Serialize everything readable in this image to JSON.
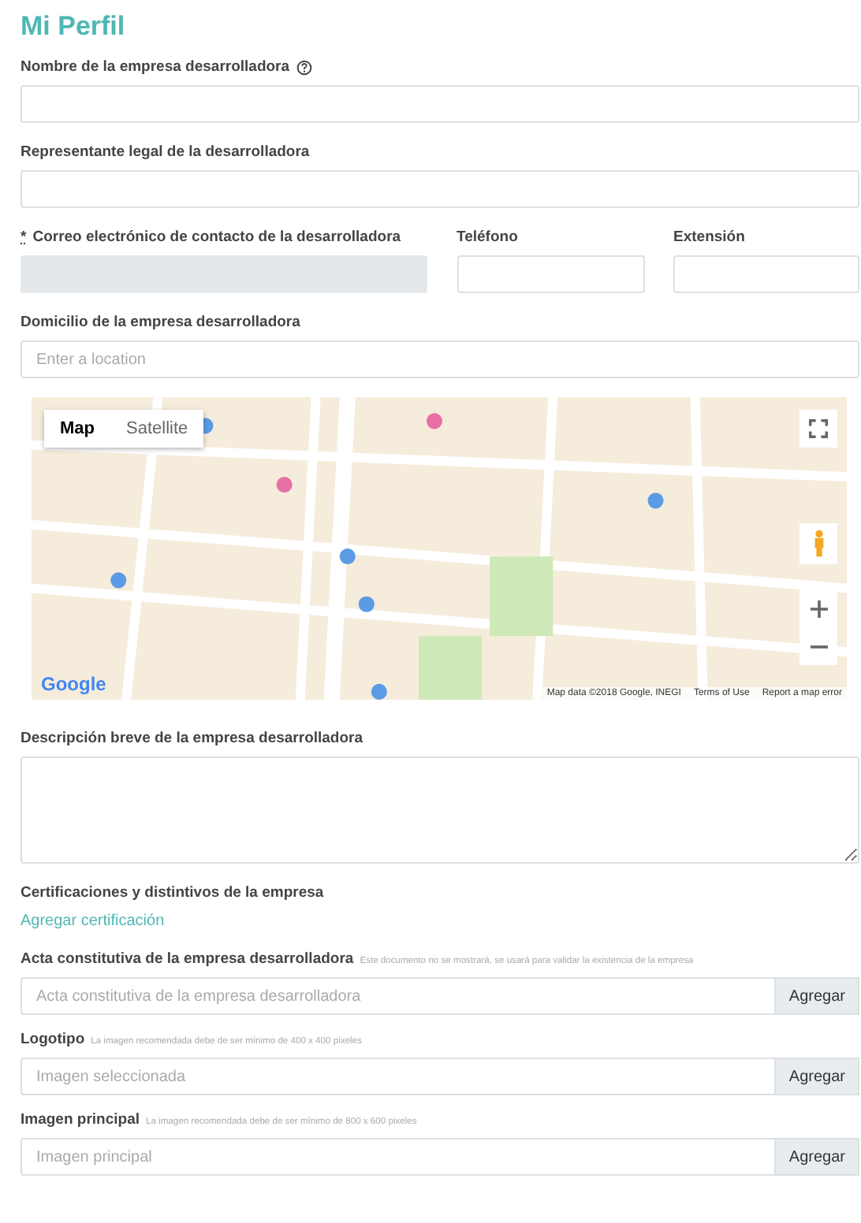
{
  "title": "Mi Perfil",
  "sections": [
    {
      "kind": "text",
      "label": "Nombre de la empresa desarrolladora",
      "help": true
    },
    {
      "kind": "text",
      "label": "Representante legal de la desarrolladora"
    },
    {
      "kind": "row",
      "fields": [
        {
          "label": "Correo electrónico de contacto de la desarrolladora",
          "required_mark": "*",
          "disabled": true
        },
        {
          "label": "Teléfono",
          "disabled": false
        },
        {
          "label": "Extensión",
          "disabled": false
        }
      ]
    },
    {
      "kind": "text",
      "label": "Domicilio de la empresa desarrolladora",
      "placeholder": "Enter a location"
    },
    {
      "kind": "map",
      "map_types": [
        {
          "label": "Map",
          "selected": true
        },
        {
          "label": "Satellite",
          "selected": false
        }
      ],
      "logo": "Google",
      "attribution": [
        "Map data ©2018 Google, INEGI",
        "Terms of Use",
        "Report a map error"
      ]
    },
    {
      "kind": "textarea",
      "label": "Descripción breve de la empresa desarrolladora"
    },
    {
      "kind": "link",
      "label": "Certificaciones y distintivos de la empresa",
      "link": "Agregar certificación"
    },
    {
      "kind": "file",
      "label": "Acta constitutiva de la empresa desarrolladora",
      "hint": "Este documento no se mostrará, se usará para validar la existencia de la empresa",
      "placeholder": "Acta constitutiva de la empresa desarrolladora",
      "button": "Agregar"
    },
    {
      "kind": "file",
      "label": "Logotipo",
      "hint": "La imagen recomendada debe de ser mínimo de 400 x 400 pixeles",
      "placeholder": "Imagen seleccionada",
      "button": "Agregar"
    },
    {
      "kind": "file",
      "label": "Imagen principal",
      "hint": "La imagen recomendada debe de ser mínimo de 800 x 600 pixeles",
      "placeholder": "Imagen principal",
      "button": "Agregar"
    }
  ]
}
